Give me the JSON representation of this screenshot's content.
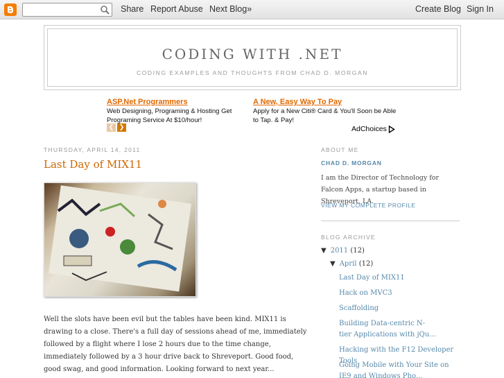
{
  "navbar": {
    "search_placeholder": "",
    "share": "Share",
    "report_abuse": "Report Abuse",
    "next_blog": "Next Blog»",
    "create_blog": "Create Blog",
    "sign_in": "Sign In"
  },
  "header": {
    "title": "CODING WITH .NET",
    "description": "CODING EXAMPLES AND THOUGHTS FROM CHAD D. MORGAN"
  },
  "ads": [
    {
      "title": "ASP.Net Programmers",
      "text": "Web Designing, Programing & Hosting Get Programing Service At $10/hour!"
    },
    {
      "title": "A New, Easy Way To Pay",
      "text": "Apply for a New Citi® Card & You'll Soon be Able to Tap. & Pay!"
    }
  ],
  "adchoices": "AdChoices",
  "post": {
    "date": "THURSDAY, APRIL 14, 2011",
    "title": "Last Day of MIX11",
    "body": "Well the slots have been evil but the tables have been kind.  MIX11 is drawing to a close.  There's a full day of sessions ahead of me, immediately followed by a flight where I lose 2 hours due to the time change, immediately followed by a 3 hour drive back to Shreveport.  Good food, good swag, and good information.  Looking forward to next year..."
  },
  "sidebar": {
    "about_heading": "ABOUT ME",
    "author_name": "CHAD D. MORGAN",
    "author_bio": "I am the Director of Technology for Falcon Apps, a startup based in Shreveport, LA.",
    "profile_link": "VIEW MY COMPLETE PROFILE",
    "archive_heading": "BLOG ARCHIVE",
    "archive_year": "2011",
    "archive_year_count": "(12)",
    "archive_month": "April",
    "archive_month_count": "(12)",
    "archive_posts": [
      "Last Day of MIX11",
      "Hack on MVC3",
      "Scaffolding",
      "Building Data-centric N-tier Applications with jQu...",
      "Hacking with the F12 Developer Tools",
      "Going Mobile with Your Site on IE9 and Windows Pho..."
    ]
  },
  "colors": {
    "link_orange": "#cc6600",
    "sidebar_blue": "#5588aa",
    "blogger_orange": "#f57d00"
  }
}
